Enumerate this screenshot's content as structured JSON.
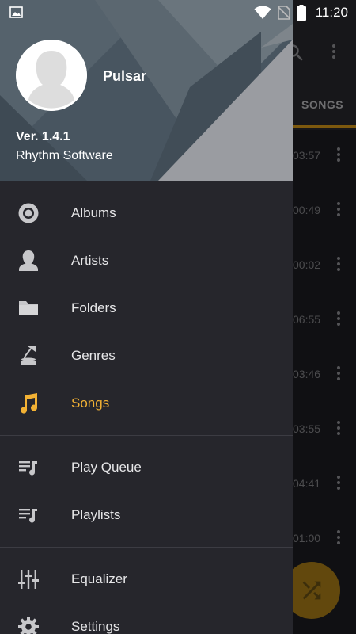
{
  "status_bar": {
    "time": "11:20"
  },
  "drawer": {
    "app_name": "Pulsar",
    "version": "Ver. 1.4.1",
    "company": "Rhythm Software",
    "sections": [
      [
        {
          "label": "Albums",
          "icon": "album-icon"
        },
        {
          "label": "Artists",
          "icon": "artist-icon"
        },
        {
          "label": "Folders",
          "icon": "folder-icon"
        },
        {
          "label": "Genres",
          "icon": "gramophone-icon"
        },
        {
          "label": "Songs",
          "icon": "music-note-icon",
          "active": true
        }
      ],
      [
        {
          "label": "Play Queue",
          "icon": "queue-music-icon"
        },
        {
          "label": "Playlists",
          "icon": "playlist-icon"
        }
      ],
      [
        {
          "label": "Equalizer",
          "icon": "equalizer-icon"
        },
        {
          "label": "Settings",
          "icon": "gear-icon"
        }
      ]
    ]
  },
  "background": {
    "active_tab": "SONGS",
    "durations": [
      "03:57",
      "00:49",
      "00:02",
      "06:55",
      "03:46",
      "03:55",
      "04:41",
      "01:00"
    ]
  },
  "colors": {
    "accent": "#f2b134",
    "drawer_bg": "#26262c",
    "header_bg": "#4a5660"
  }
}
